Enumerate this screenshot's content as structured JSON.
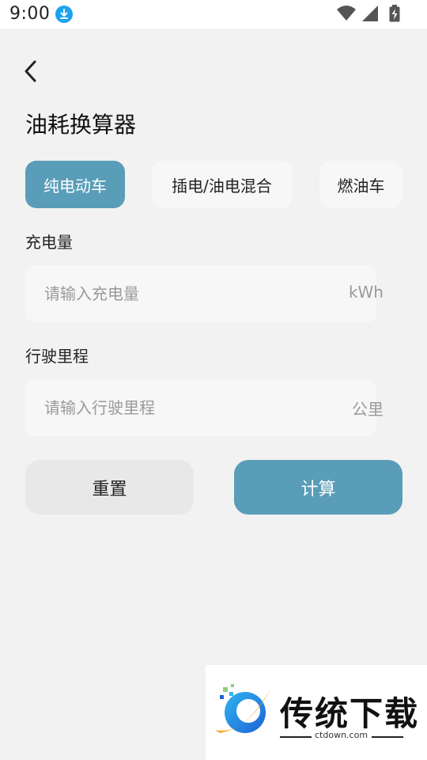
{
  "status_bar": {
    "time": "9:00",
    "icons": [
      "download-icon",
      "wifi-icon",
      "signal-icon",
      "battery-charging-icon"
    ],
    "download_color": "#1aa3ef"
  },
  "header": {
    "back_icon": "chevron-left-icon",
    "title": "油耗换算器"
  },
  "tabs": [
    {
      "label": "纯电动车",
      "active": true
    },
    {
      "label": "插电/油电混合",
      "active": false
    },
    {
      "label": "燃油车",
      "active": false
    }
  ],
  "fields": [
    {
      "label": "充电量",
      "placeholder": "请输入充电量",
      "value": "",
      "unit": "kWh"
    },
    {
      "label": "行驶里程",
      "placeholder": "请输入行驶里程",
      "value": "",
      "unit": "公里"
    }
  ],
  "buttons": {
    "reset_label": "重置",
    "calculate_label": "计算"
  },
  "watermark": {
    "brand": "传统下载",
    "url": "ctdown.com"
  },
  "colors": {
    "accent": "#5a9db9",
    "background": "#f2f2f2",
    "field_background": "#f7f7f7"
  }
}
